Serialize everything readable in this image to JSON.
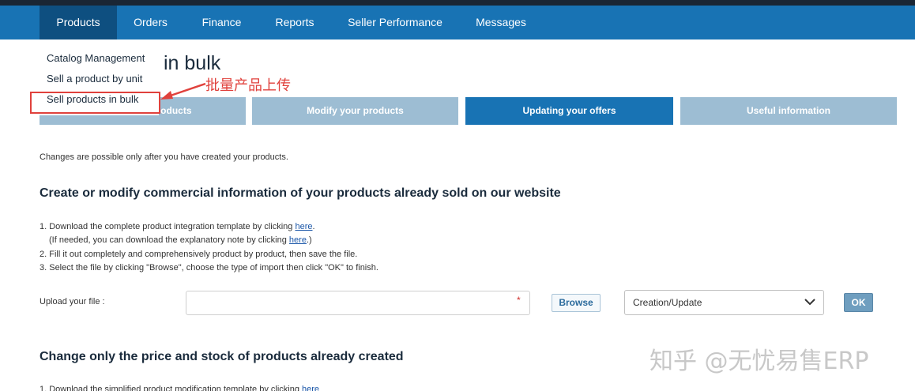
{
  "nav": {
    "items": [
      {
        "label": "Products"
      },
      {
        "label": "Orders"
      },
      {
        "label": "Finance"
      },
      {
        "label": "Reports"
      },
      {
        "label": "Seller Performance"
      },
      {
        "label": "Messages"
      }
    ]
  },
  "dropdown": {
    "items": [
      {
        "label": "Catalog Management"
      },
      {
        "label": "Sell a product by unit"
      },
      {
        "label": "Sell products in bulk"
      }
    ]
  },
  "page": {
    "title_visible": "in bulk"
  },
  "annotation": {
    "text": "批量产品上传",
    "color": "#e0413c"
  },
  "steps": [
    {
      "label": "roducts"
    },
    {
      "label": "Modify your products"
    },
    {
      "label": "Updating your offers"
    },
    {
      "label": "Useful information"
    }
  ],
  "intro": "Changes are possible only after you have created your products.",
  "section1": {
    "heading": "Create or modify commercial information of your products already sold on our website",
    "line1_pre": "1. Download the complete product integration template by clicking ",
    "line1_link": "here",
    "line1_post": ".",
    "line2_pre": "(If needed, you can download the explanatory note by clicking ",
    "line2_link": "here",
    "line2_post": ".)",
    "line3": "2. Fill it out completely and comprehensively product by product, then save the file.",
    "line4": "3. Select the file by clicking \"Browse\", choose the type of import then click \"OK\" to finish."
  },
  "upload": {
    "label": "Upload your file :",
    "required_mark": "*",
    "browse_label": "Browse",
    "select_value": "Creation/Update",
    "ok_label": "OK"
  },
  "section2": {
    "heading": "Change only the price and stock of products already created",
    "line1_pre": "1. Download the simplified product modification template by clicking ",
    "line1_link": "here"
  },
  "watermark": "知乎 @无忧易售ERP",
  "colors": {
    "nav_bg": "#1873b4",
    "nav_active": "#0e4f80",
    "step_active": "#1873b4",
    "step_inactive": "#9dbdd3",
    "link": "#1a56a8"
  }
}
